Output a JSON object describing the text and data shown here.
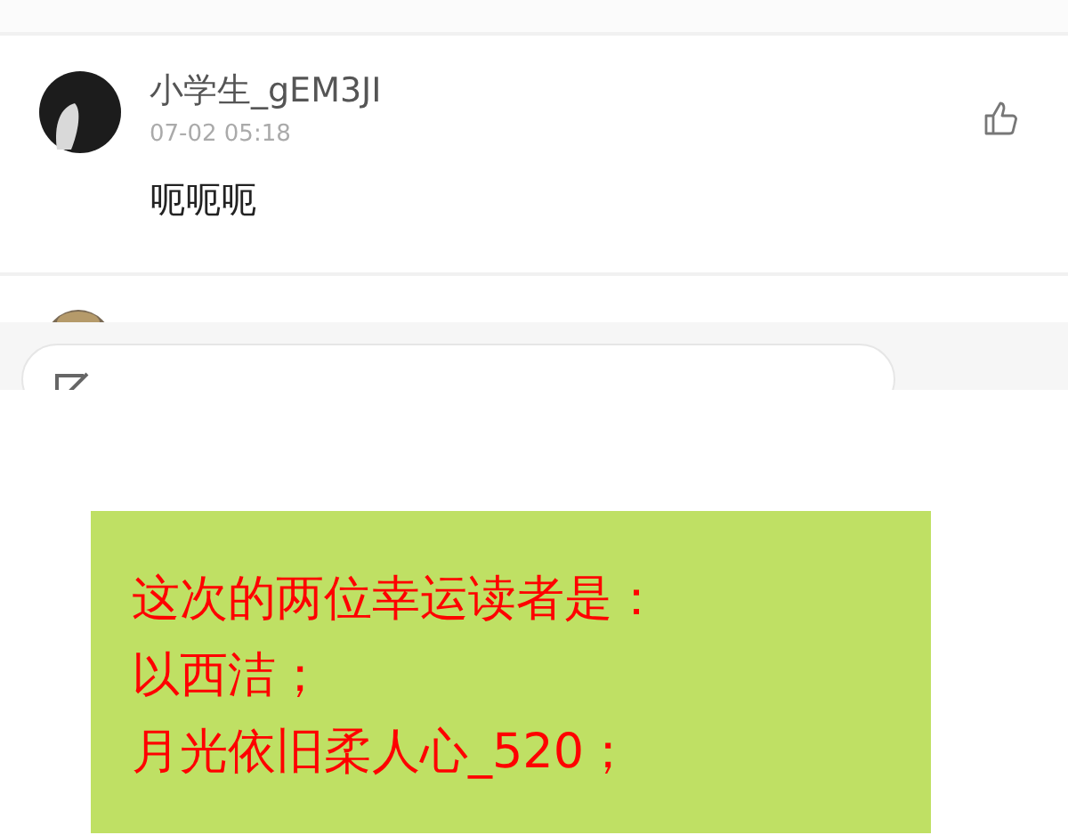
{
  "comments": [
    {
      "author": "小学生_gEM3JI",
      "time": "07-02 05:18",
      "text": "呃呃呃"
    }
  ],
  "notice": {
    "lines": [
      "这次的两位幸运读者是：",
      "以西洁；",
      "月光依旧柔人心_520；"
    ]
  }
}
